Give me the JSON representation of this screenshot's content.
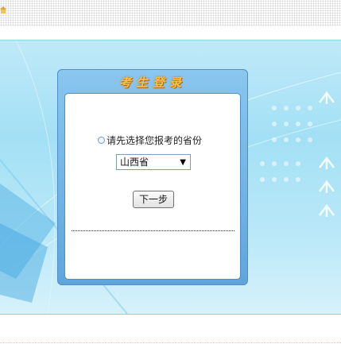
{
  "top_bar": {
    "home_icon": "home-icon"
  },
  "login_panel": {
    "title": "考生登录",
    "prompt": "请先选择您报考的省份",
    "radio_icon": "radio-icon",
    "province_select": {
      "selected": "山西省",
      "arrow_glyph": "▼"
    },
    "next_button": "下一步"
  },
  "colors": {
    "banner_blue": "#a3e0f5",
    "panel_blue": "#5fa5dc",
    "title_gold": "#f3c14a"
  }
}
